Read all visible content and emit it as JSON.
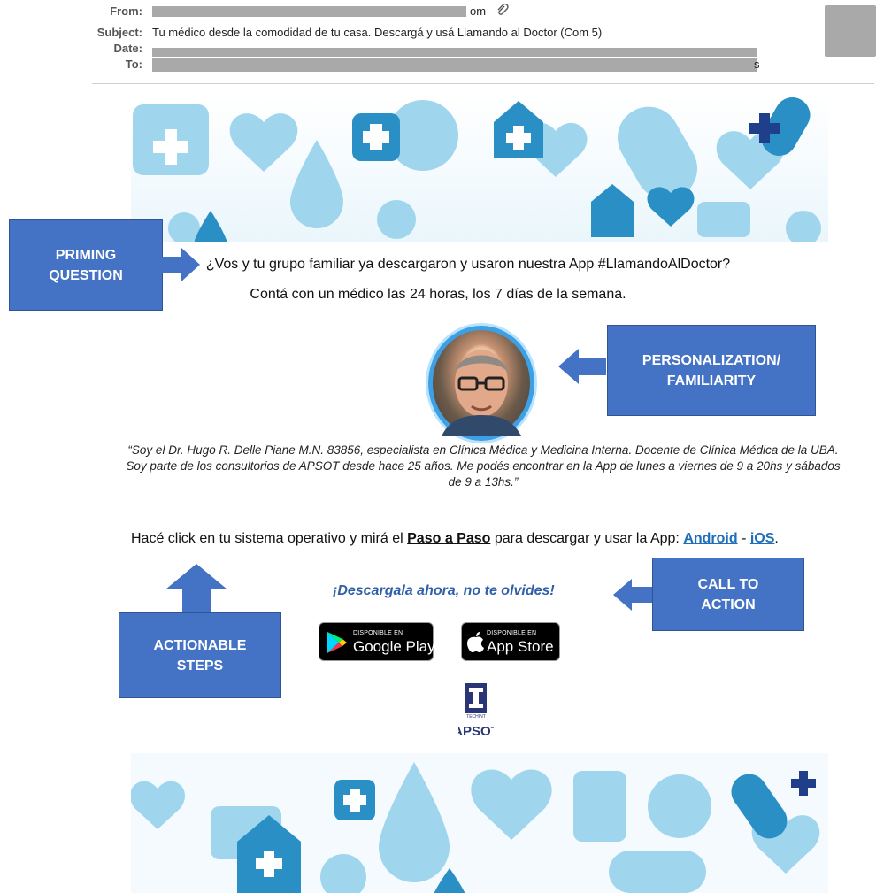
{
  "email_header": {
    "from_label": "From:",
    "from_value": "",
    "from_visible_tail": "om",
    "subject_label": "Subject:",
    "subject_value": "Tu médico desde la comodidad de tu casa. Descargá y usá Llamando al Doctor (Com 5)",
    "date_label": "Date:",
    "to_label": "To:",
    "to_tail": "s"
  },
  "callouts": {
    "priming": "PRIMING QUESTION",
    "personalization": "PERSONALIZATION/ FAMILIARITY",
    "call_to_action": "CALL TO ACTION",
    "actionable": "ACTIONABLE STEPS"
  },
  "body": {
    "question": "¿Vos y tu grupo familiar ya descargaron y usaron nuestra App #LlamandoAlDoctor?",
    "subline": "Contá con un médico las 24 horas, los 7 días de la semana.",
    "quote": "“Soy el Dr. Hugo R. Delle Piane M.N. 83856, especialista en Clínica Médica y Medicina Interna. Docente de Clínica Médica de la UBA. Soy parte de los consultorios de APSOT desde hace 25 años. Me podés encontrar en la App de lunes a viernes de 9 a 20hs y sábados de 9 a 13hs.”",
    "click_prefix": "Hacé click en tu sistema operativo y mirá el ",
    "step_link": "Paso a Paso",
    "click_middle": " para descargar y usar la App: ",
    "android_link": "Android",
    "separator": " - ",
    "ios_link": "iOS",
    "click_suffix": ".",
    "reminder": "¡Descargala ahora, no te olvides!"
  },
  "stores": {
    "google_small": "DISPONIBLE EN",
    "google_big": "Google Play",
    "apple_small": "DISPONIBLE EN",
    "apple_big": "App Store"
  },
  "logo": {
    "tag": "TECHINT",
    "name": "APSOT"
  },
  "colors": {
    "callout": "#4472c4",
    "link": "#1e6fb8",
    "reminder": "#2e5fa8",
    "banner_light": "#9fd6ee",
    "banner_dark": "#2a8fc4"
  },
  "icons": [
    "attachment-icon",
    "medical-pattern",
    "google-play-icon",
    "apple-icon",
    "apsot-logo"
  ]
}
